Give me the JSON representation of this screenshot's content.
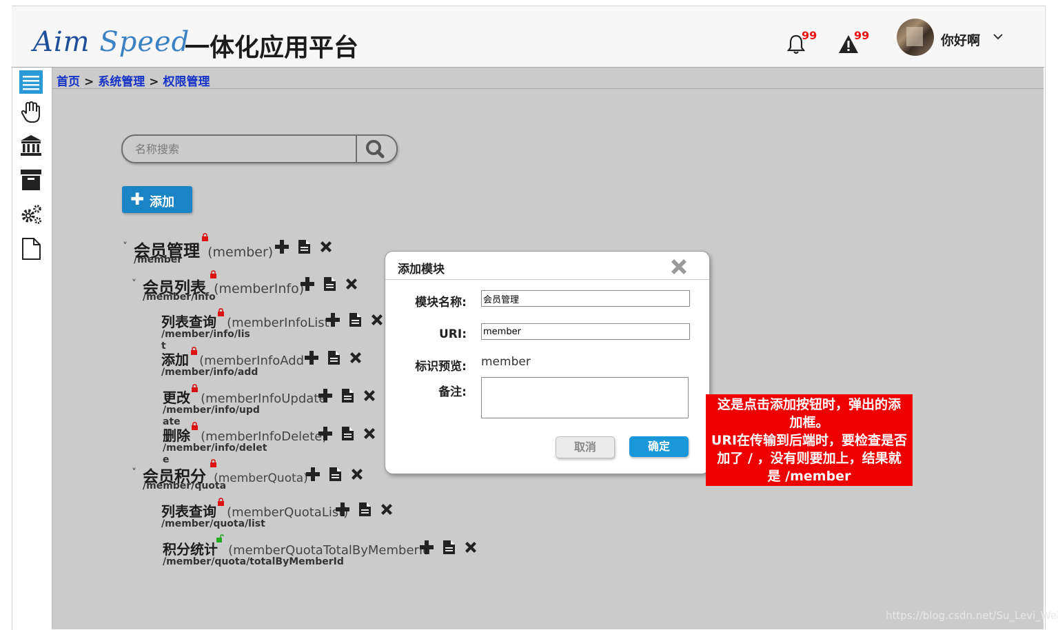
{
  "header": {
    "logo_part1": "Aim",
    "logo_part2": "Speed",
    "app_title": "一体化应用平台",
    "notifications_count": "99",
    "alerts_count": "99",
    "username": "你好啊"
  },
  "sidebar": {
    "icons": [
      "menu-icon",
      "hand-icon",
      "bank-icon",
      "archive-icon",
      "gears-icon",
      "file-icon"
    ]
  },
  "breadcrumb": {
    "home": "首页",
    "sep": ">",
    "system": "系统管理",
    "current": "权限管理"
  },
  "search": {
    "placeholder": "名称搜索"
  },
  "add_button": {
    "label": "添加"
  },
  "tree": [
    {
      "name": "会员管理",
      "code": "(member)",
      "uri": "/member",
      "locked": true
    },
    {
      "name": "会员列表",
      "code": "(memberInfo)",
      "uri": "/member/info",
      "locked": true
    },
    {
      "name": "列表查询",
      "code": "(memberInfoList",
      "uri": "/member/info/lis",
      "uri_tail": "t",
      "locked": true
    },
    {
      "name": "添加",
      "code": "(memberInfoAdd",
      "uri": "/member/info/add",
      "locked": true
    },
    {
      "name": "更改",
      "code": "(memberInfoUpdate",
      "uri": "/member/info/upd",
      "uri_tail": "ate",
      "locked": true
    },
    {
      "name": "删除",
      "code": "(memberInfoDelete)",
      "uri": "/member/info/delet",
      "uri_tail": "e",
      "locked": true
    },
    {
      "name": "会员积分",
      "code": "(memberQuota)",
      "uri": "/member/quota",
      "locked": true
    },
    {
      "name": "列表查询",
      "code": "(memberQuotaList)",
      "uri": "/member/quota/list",
      "locked": true
    },
    {
      "name": "积分统计",
      "code": "(memberQuotaTotalByMemberId",
      "uri": "/member/quota/totalByMemberId",
      "locked": false
    }
  ],
  "modal": {
    "title": "添加模块",
    "name_label": "模块名称:",
    "name_value": "会员管理",
    "uri_label": "URI:",
    "uri_value": "member",
    "preview_label": "标识预览:",
    "preview_value": "member",
    "remark_label": "备注:",
    "cancel_label": "取消",
    "ok_label": "确定"
  },
  "annotation": {
    "line1": "这是点击添加按钮时，弹出的添",
    "line2": "加框。",
    "line3": "URI在传输到后端时，要检查是否",
    "line4": "加了 / ，没有则要加上，结果就",
    "line5": "是 /member"
  },
  "watermark": "https://blog.csdn.net/Su_Levi_Wei",
  "colors": {
    "accent": "#1b84c4",
    "header_bg": "#f7f7f7",
    "content_bg": "#cbcbcb",
    "note_bg": "#ee0000",
    "lock_red": "#dd1111",
    "lock_green": "#22aa22",
    "badge": "#ee1111"
  }
}
